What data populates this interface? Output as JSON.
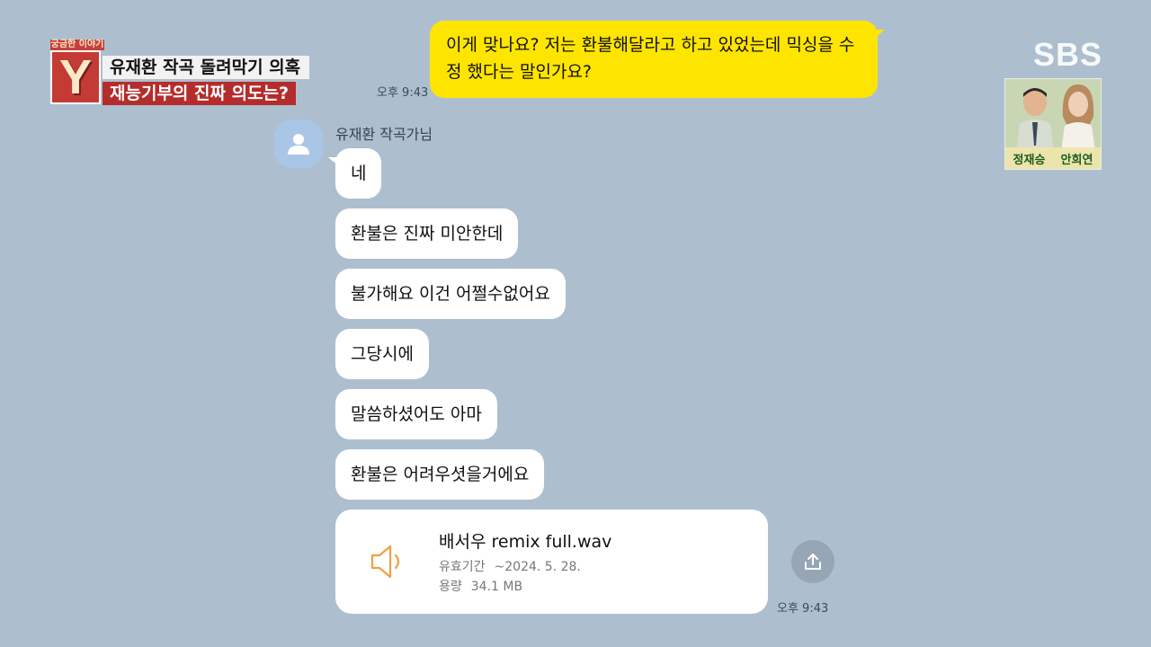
{
  "overlay": {
    "logo_top": "궁금한 이야기",
    "logo_letter": "Y",
    "caption1": "유재환 작곡 돌려막기 의혹",
    "caption2": "재능기부의 진짜 의도는?",
    "broadcaster": "SBS",
    "hosts": [
      "정재승",
      "안희연"
    ]
  },
  "chat": {
    "sent": {
      "text": "이게 맞나요? 저는 환불해달라고 하고 있었는데 믹싱을 수정 했다는 말인가요?",
      "time": "오후 9:43"
    },
    "sender_name": "유재환 작곡가님",
    "received": [
      "네",
      "환불은 진짜 미안한데",
      "불가해요 이건 어쩔수없어요",
      "그당시에",
      "말씀하셨어도 아마",
      "환불은 어려우셧을거에요"
    ],
    "file": {
      "name": "배서우 remix full.wav",
      "validity_label": "유효기간",
      "validity_value": "~2024. 5. 28.",
      "size_label": "용량",
      "size_value": "34.1 MB"
    },
    "received_time": "오후 9:43"
  },
  "icons": {
    "avatar": "person-icon",
    "file": "speaker-icon",
    "share": "share-icon"
  },
  "colors": {
    "background": "#adbfcf",
    "sent_bubble": "#fee500",
    "received_bubble": "#ffffff",
    "accent_orange": "#f0a040"
  }
}
